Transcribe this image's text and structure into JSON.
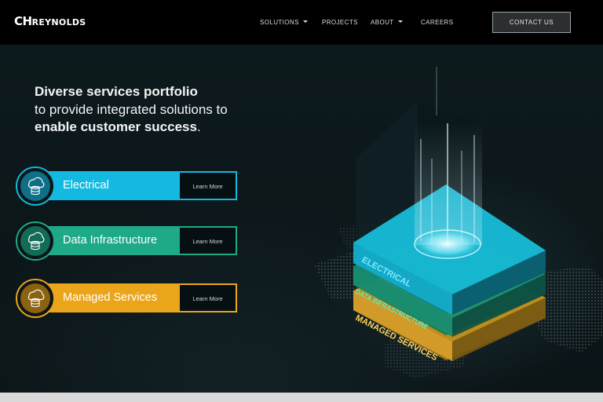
{
  "header": {
    "logo_big": "CH",
    "logo_small": "Reynolds",
    "nav": [
      {
        "label": "SOLUTIONS",
        "has_dropdown": true
      },
      {
        "label": "PROJECTS",
        "has_dropdown": false
      },
      {
        "label": "ABOUT",
        "has_dropdown": true
      },
      {
        "label": "CAREERS",
        "has_dropdown": false
      }
    ],
    "contact_label": "CONTACT US"
  },
  "hero": {
    "line1": "Diverse services portfolio",
    "line2": "to provide integrated solutions to",
    "line3_bold": "enable customer success",
    "line3_end": "."
  },
  "services": [
    {
      "label": "Electrical",
      "button": "Learn More",
      "color": "#13b9e0",
      "icon": "cloud-database-icon"
    },
    {
      "label": "Data Infrastructure",
      "button": "Learn More",
      "color": "#1ea987",
      "icon": "cloud-database-icon"
    },
    {
      "label": "Managed Services",
      "button": "Learn More",
      "color": "#eba51b",
      "icon": "cloud-database-icon"
    }
  ],
  "illustration": {
    "layer_top": "ELECTRICAL",
    "layer_mid": "DATA INFRASTRUCTURE",
    "layer_bottom": "MANAGED SERVICES"
  }
}
